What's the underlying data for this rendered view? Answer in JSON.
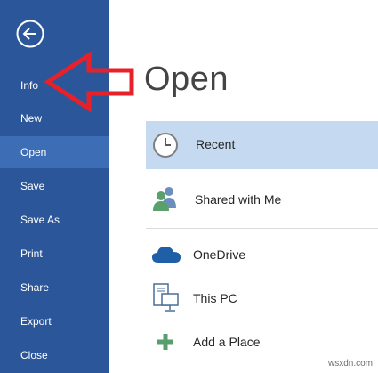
{
  "sidebar": {
    "back_icon": "back-arrow-circle-icon",
    "items": [
      {
        "label": "Info"
      },
      {
        "label": "New"
      },
      {
        "label": "Open"
      },
      {
        "label": "Save"
      },
      {
        "label": "Save As"
      },
      {
        "label": "Print"
      },
      {
        "label": "Share"
      },
      {
        "label": "Export"
      },
      {
        "label": "Close"
      }
    ],
    "selected": "Open"
  },
  "main": {
    "title": "Open",
    "locations": [
      {
        "label": "Recent",
        "icon": "clock-icon",
        "selected": true
      },
      {
        "label": "Shared with Me",
        "icon": "people-icon"
      },
      {
        "label": "OneDrive",
        "icon": "cloud-icon"
      },
      {
        "label": "This PC",
        "icon": "computer-icon"
      },
      {
        "label": "Add a Place",
        "icon": "plus-icon"
      }
    ]
  },
  "annotation": {
    "icon": "red-arrow-icon",
    "color": "#e8202a"
  },
  "watermark": "wsxdn.com",
  "colors": {
    "sidebar": "#2b579a",
    "selected_nav": "#3d6db5",
    "selected_location": "#c5d9f1"
  }
}
